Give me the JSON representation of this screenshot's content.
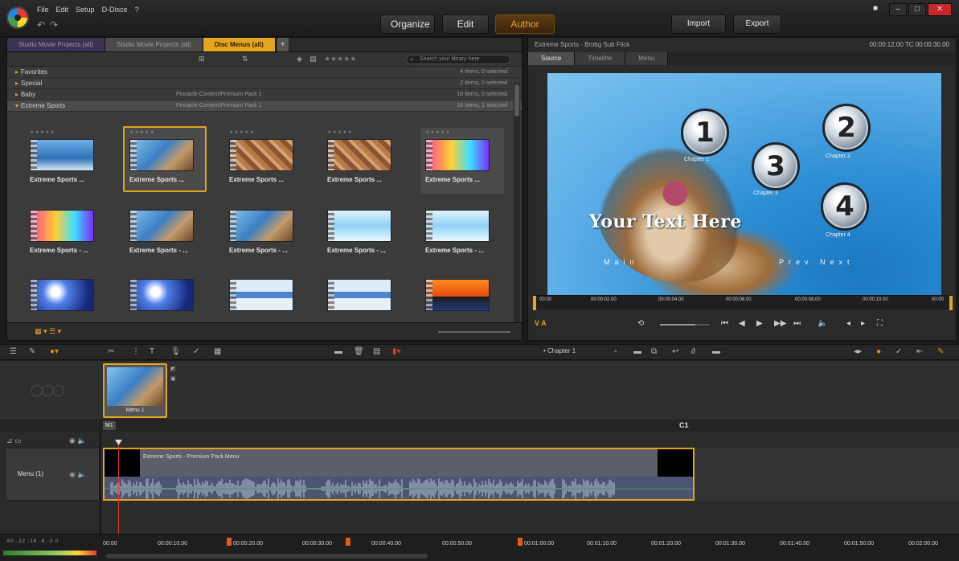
{
  "menubar": [
    "File",
    "Edit",
    "Setup",
    "D-Disce",
    "?"
  ],
  "modes": [
    "Organize",
    "Edit",
    "Author"
  ],
  "header_buttons": {
    "import": "Import",
    "export": "Export"
  },
  "window_controls": [
    "■",
    "–",
    "□",
    "✕"
  ],
  "library": {
    "tabs": [
      "Studio Movie Projects (all)",
      "Studio Movie Projects (all)",
      "Disc Menus (all)"
    ],
    "search_placeholder": "Search your library here",
    "tree": [
      {
        "label": "Favorites",
        "count": "4 Items, 0 selected",
        "path": ""
      },
      {
        "label": "Special",
        "count": "2 Items, 0 selected",
        "path": ""
      },
      {
        "label": "Baby",
        "count": "16 Items, 0 selected",
        "path": "Pinnacle Content\\Premium Pack 1"
      },
      {
        "label": "Extreme Sports",
        "count": "16 Items, 1 selected",
        "path": "Pinnacle Content\\Premium Pack 1"
      }
    ],
    "stars": "★★★★★",
    "thumbs": [
      {
        "caption": "Extreme Sports ..."
      },
      {
        "caption": "Extreme Sports ..."
      },
      {
        "caption": "Extreme Sports ..."
      },
      {
        "caption": "Extreme Sports ..."
      },
      {
        "caption": "Extreme Sports ..."
      },
      {
        "caption": "Extreme Sports - ..."
      },
      {
        "caption": "Extreme Sports - ..."
      },
      {
        "caption": "Extreme Sports - ..."
      },
      {
        "caption": "Extreme Sports - ..."
      },
      {
        "caption": "Extreme Sports - ..."
      },
      {
        "caption": ""
      },
      {
        "caption": ""
      },
      {
        "caption": ""
      },
      {
        "caption": ""
      },
      {
        "caption": ""
      }
    ]
  },
  "player": {
    "title": "Extreme Sports - Bmbg Sub Flick",
    "timecode": "00:00:12.00   TC 00:00:30.00",
    "tabs": [
      "Source",
      "Timeline",
      "Menu"
    ],
    "chapters": [
      "1",
      "2",
      "3",
      "4"
    ],
    "chapter_labels": [
      "Chapter 1",
      "Chapter 2",
      "Chapter 3",
      "Chapter 4"
    ],
    "text_placeholder": "Your Text Here",
    "nav_left": "Main",
    "nav_right": "Prev Next",
    "ruler_ticks": [
      "00:00",
      "00:00:02.00",
      "00:00:04.00",
      "00:00:06.00",
      "00:00:08.00",
      "00:00:10.00",
      "00:00"
    ],
    "va_label": "V A"
  },
  "timeline": {
    "chapter_select": "• Chapter 1",
    "menu_clip_caption": "Menu 1",
    "menu_flag": "M1",
    "end_flag": "C1",
    "track_name": "Menu (1)",
    "clip_label": "Extreme Sports - Premium Pack Menu",
    "ruler_ticks": [
      "00:00",
      "00:00:10.00",
      "00:00:20.00",
      "00:00:30.00",
      "00:00:40.00",
      "00:00:50.00",
      "00:01:00.00",
      "00:01:10.00",
      "00:01:20.00",
      "00:01:30.00",
      "00:01:40.00",
      "00:01:50.00",
      "00:02:00.00"
    ],
    "meter_label": "-60 -22 -16 -6 -3 0"
  },
  "colors": {
    "accent": "#e3a51f",
    "playhead": "#e23c2c"
  }
}
